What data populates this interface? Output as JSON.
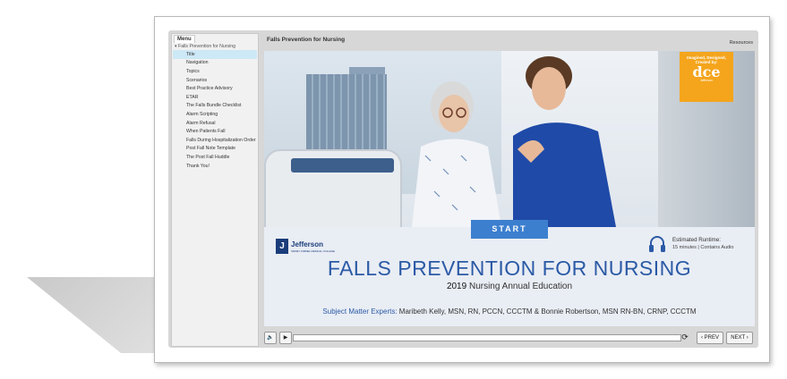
{
  "sidebar": {
    "tab_label": "Menu",
    "root_label": "Falls Prevention for Nursing",
    "items": [
      {
        "label": "Title"
      },
      {
        "label": "Navigation"
      },
      {
        "label": "Topics"
      },
      {
        "label": "Scenarios"
      },
      {
        "label": "Best Practice Advisory"
      },
      {
        "label": "ETAR"
      },
      {
        "label": "The Falls Bundle Checklist"
      },
      {
        "label": "Alarm Scripting"
      },
      {
        "label": "Alarm Refusal"
      },
      {
        "label": "When Patients Fall"
      },
      {
        "label": "Falls During Hospitalization Order"
      },
      {
        "label": "Post Fall Note Template"
      },
      {
        "label": "The Post Fall Huddle"
      },
      {
        "label": "Thank You!"
      }
    ],
    "active_index": 0
  },
  "header": {
    "title": "Falls Prevention for Nursing",
    "resources_label": "Resources"
  },
  "slide": {
    "badge": {
      "line1": "Imagined, Designed,",
      "line2": "Created by:",
      "logo": "dce",
      "sub": "Jefferson"
    },
    "start_label": "START",
    "logo_name": "Jefferson",
    "logo_sub": "SIDNEY KIMMEL MEDICAL COLLEGE",
    "runtime_label": "Estimated Runtime:",
    "runtime_detail": "15 minutes  |  Contains Audio",
    "main_title": "FALLS PREVENTION FOR NURSING",
    "subtitle_year": "2019",
    "subtitle_rest": " Nursing Annual Education",
    "experts_label": "Subject Matter Experts:",
    "experts_names": " Maribeth Kelly, MSN, RN, PCCN, CCCTM & Bonnie Robertson, MSN RN-BN, CRNP, CCCTM"
  },
  "controls": {
    "volume_icon": "🔈",
    "play_icon": "▶",
    "replay_icon": "⟳",
    "prev_label": "‹ PREV",
    "next_label": "NEXT ›"
  },
  "colors": {
    "accent": "#3d7fcf",
    "title_blue": "#2b5aa6",
    "badge": "#f4a51c",
    "jefferson": "#1a3d7a"
  }
}
